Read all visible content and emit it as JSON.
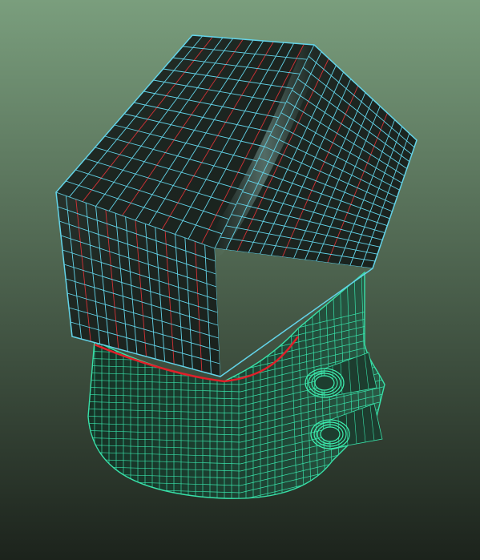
{
  "viewport": {
    "background_top": "#7a9e7d",
    "background_bottom": "#1c231c",
    "shading": "smooth-shaded-wireframe"
  },
  "model": {
    "lid": {
      "surface_color": "#1f2a24",
      "highlight_color": "#6e8e88",
      "wire_color": "#63d3e8",
      "seam_color": "#d43236"
    },
    "base": {
      "surface_color": "#1d3d2f",
      "wire_color": "#38e0a8",
      "boss_color": "#3df0b0"
    },
    "seam_line_color": "#e0202a"
  }
}
